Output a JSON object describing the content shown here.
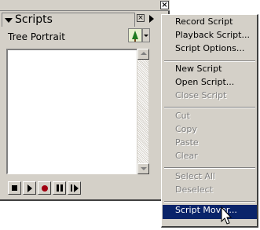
{
  "palette": {
    "tab_title": "Scripts",
    "close_glyph": "×",
    "tab_close_glyph": "×",
    "document_name": "Tree Portrait",
    "controls": [
      {
        "name": "stop-button",
        "icon": "stop-icon"
      },
      {
        "name": "play-button",
        "icon": "play-icon"
      },
      {
        "name": "record-button",
        "icon": "record-icon"
      },
      {
        "name": "pause-button",
        "icon": "pause-icon"
      },
      {
        "name": "step-button",
        "icon": "step-icon"
      }
    ]
  },
  "menu": {
    "items": [
      {
        "label": "Record Script",
        "enabled": true
      },
      {
        "label": "Playback Script...",
        "enabled": true
      },
      {
        "label": "Script Options...",
        "enabled": true
      },
      {
        "label": "New Script",
        "enabled": true
      },
      {
        "label": "Open Script...",
        "enabled": true
      },
      {
        "label": "Close Script",
        "enabled": false
      },
      {
        "label": "Cut",
        "enabled": false
      },
      {
        "label": "Copy",
        "enabled": false
      },
      {
        "label": "Paste",
        "enabled": false
      },
      {
        "label": "Clear",
        "enabled": false
      },
      {
        "label": "Select All",
        "enabled": false
      },
      {
        "label": "Deselect",
        "enabled": false
      },
      {
        "label": "Script Mover...",
        "enabled": true,
        "selected": true
      }
    ]
  },
  "colors": {
    "face": "#d4d0c8",
    "highlight": "#0a246a",
    "record": "#a00010"
  }
}
